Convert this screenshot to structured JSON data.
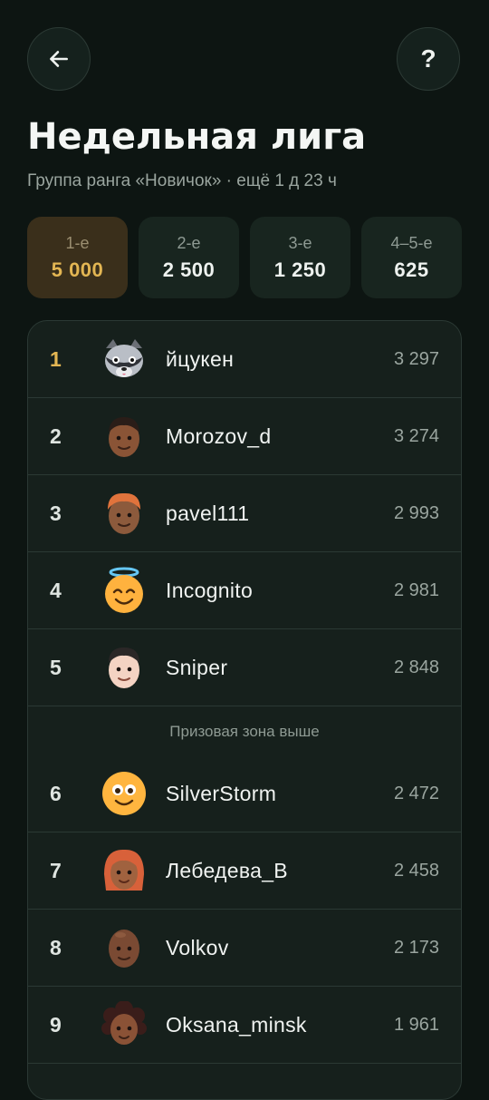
{
  "header": {
    "title": "Недельная лига",
    "subtitle": "Группа ранга «Новичок» · ещё 1 д 23 ч",
    "back_icon": "arrow-left-icon",
    "help_label": "?"
  },
  "prizes": [
    {
      "place": "1-е",
      "amount": "5 000"
    },
    {
      "place": "2-е",
      "amount": "2 500"
    },
    {
      "place": "3-е",
      "amount": "1 250"
    },
    {
      "place": "4–5-е",
      "amount": "625"
    }
  ],
  "leaderboard": {
    "rows": [
      {
        "rank": "1",
        "name": "йцукен",
        "score": "3 297",
        "avatar": "raccoon-avatar-icon"
      },
      {
        "rank": "2",
        "name": "Morozov_d",
        "score": "3 274",
        "avatar": "man-dark-hair-avatar-icon"
      },
      {
        "rank": "3",
        "name": "pavel111",
        "score": "2 993",
        "avatar": "man-red-hair-avatar-icon"
      },
      {
        "rank": "4",
        "name": "Incognito",
        "score": "2 981",
        "avatar": "angel-smiley-icon"
      },
      {
        "rank": "5",
        "name": "Sniper",
        "score": "2 848",
        "avatar": "man-light-avatar-icon"
      },
      {
        "rank": "6",
        "name": "SilverStorm",
        "score": "2 472",
        "avatar": "smiley-face-icon"
      },
      {
        "rank": "7",
        "name": "Лебедева_В",
        "score": "2 458",
        "avatar": "woman-red-hair-avatar-icon"
      },
      {
        "rank": "8",
        "name": "Volkov",
        "score": "2 173",
        "avatar": "man-bald-avatar-icon"
      },
      {
        "rank": "9",
        "name": "Oksana_minsk",
        "score": "1 961",
        "avatar": "woman-curly-hair-avatar-icon"
      }
    ],
    "prize_zone_label": "Призовая зона выше"
  },
  "colors": {
    "background": "#0d1512",
    "gold": "#e3b653",
    "card": "#18251f"
  }
}
